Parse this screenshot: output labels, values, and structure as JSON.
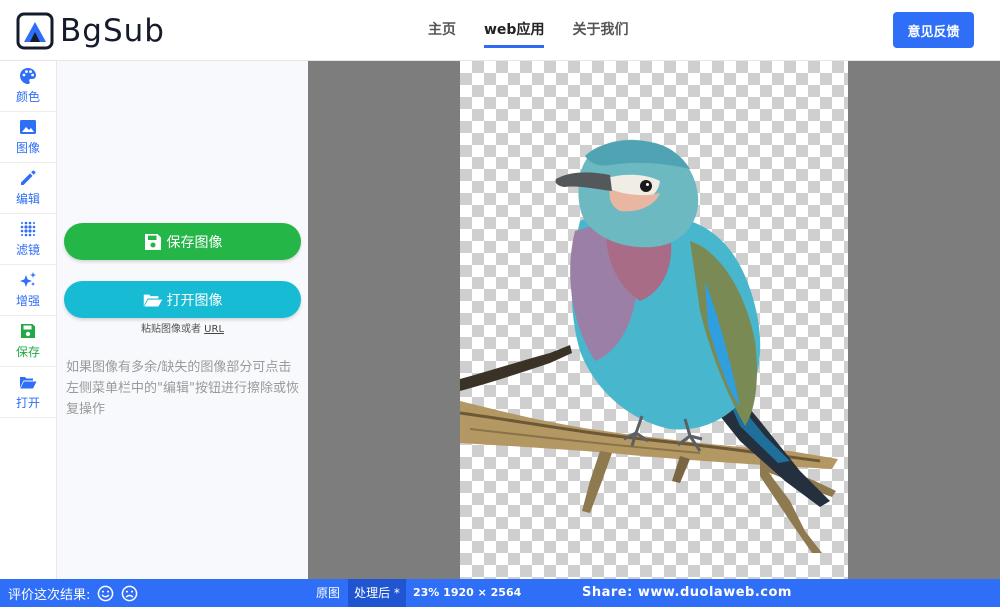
{
  "header": {
    "logo_text": "BgSub",
    "nav": [
      {
        "label": "主页",
        "active": false
      },
      {
        "label": "web应用",
        "active": true
      },
      {
        "label": "关于我们",
        "active": false
      }
    ],
    "feedback_label": "意见反馈"
  },
  "rail": {
    "items": [
      {
        "label": "颜色",
        "icon": "palette-icon",
        "color": "#2f6ef6"
      },
      {
        "label": "图像",
        "icon": "image-icon",
        "color": "#2f6ef6"
      },
      {
        "label": "编辑",
        "icon": "pencil-icon",
        "color": "#2f6ef6"
      },
      {
        "label": "滤镜",
        "icon": "dot-grid-icon",
        "color": "#2f6ef6"
      },
      {
        "label": "增强",
        "icon": "sparkle-icon",
        "color": "#2f6ef6"
      },
      {
        "label": "保存",
        "icon": "floppy-disk-icon",
        "color": "#22a846"
      },
      {
        "label": "打开",
        "icon": "folder-open-icon",
        "color": "#2f6ef6"
      }
    ]
  },
  "panel": {
    "save_label": "保存图像",
    "open_label": "打开图像",
    "paste_prefix": "粘贴图像或者",
    "paste_link": "URL",
    "tip": "如果图像有多余/缺失的图像部分可点击左侧菜单栏中的\"编辑\"按钮进行擦除或恢复操作"
  },
  "status": {
    "rate_label": "评价这次结果:",
    "view_original": "原图",
    "view_processed": "处理后 *",
    "info": "23% 1920 × 2564",
    "share": "Share:  www.duolaweb.com"
  },
  "colors": {
    "accent": "#2f6ef6",
    "save_green": "#25b648",
    "open_cyan": "#17bcd4"
  }
}
